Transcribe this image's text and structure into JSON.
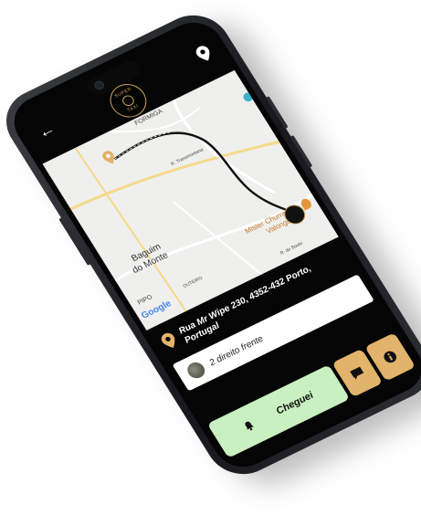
{
  "header": {
    "back_icon": "arrow-left-icon",
    "logo_text": "SUPER",
    "logo_subtext": "TAXI",
    "location_icon": "map-pin-icon"
  },
  "map": {
    "labels": {
      "formiga": "FORMIGA",
      "road": "R. Transmontana",
      "baguim": "Baguim",
      "baguim2": "do Monte",
      "pipo": "PIPO",
      "outeiro": "OUTEIRO",
      "restaurant": "Mister Churrasco",
      "restaurant2": "Valongo",
      "street": "R. do Souto"
    },
    "google": "Google",
    "route_color": "#111111",
    "pin_color": "#e2b36a"
  },
  "destination": {
    "address": "Rua Mr Wipe 230, 4352-432 Porto, Portugal"
  },
  "note": {
    "text": "2 direito frente"
  },
  "actions": {
    "arrived_label": "Cheguei",
    "arrived_icon": "bell-icon",
    "chat_icon": "chat-icon",
    "info_icon": "info-icon"
  },
  "colors": {
    "arrived_bg": "#c9f0c0",
    "action_bg": "#e2b36a",
    "screen_bg": "#050505"
  }
}
